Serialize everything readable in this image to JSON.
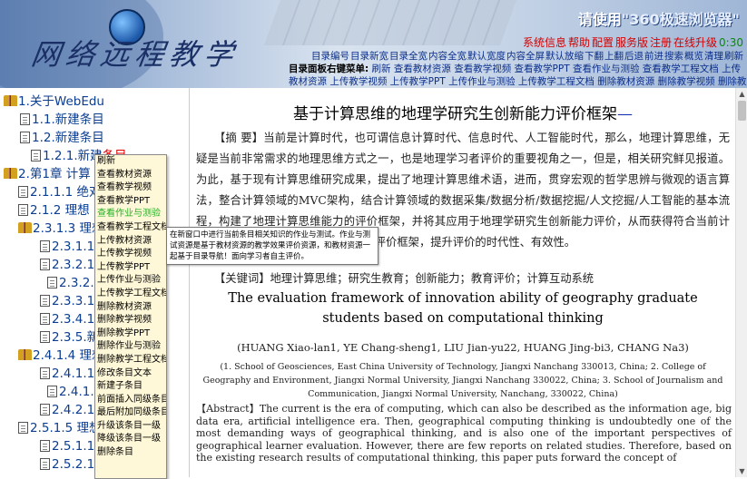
{
  "banner": {
    "logo_text": "网络远程教学",
    "welcome_prefix": "请使用",
    "welcome_browser": "\"360极速浏览器\"",
    "sys_links": [
      "系统信息",
      "帮助",
      "配置",
      "服务版",
      "注册",
      "在线升级"
    ],
    "time": "0:30",
    "nav_links": [
      "目录编号",
      "目录新宽",
      "目录全宽",
      "内容全宽",
      "默认宽度",
      "内容全屏",
      "默认放缩",
      "下翻",
      "上翻",
      "后退",
      "前进",
      "搜索",
      "概览",
      "清理",
      "刷新"
    ],
    "menu_label": "目录面板右键菜单:",
    "menu_items": "刷新 查看教材资源 查看教学视频 查看教学PPT 查看作业与测验 查看教学工程文档 上传教材资源 上传教学视频 上传教学PPT 上传作业与测验 上传教学工程文档 删除教材资源 删除教学视频 删除教学PPT 删除作"
  },
  "tree": [
    {
      "label": "1.关于WebEdu",
      "icon": "book"
    },
    {
      "label": "1.1.新建条目",
      "icon": "doc"
    },
    {
      "label": "1.2.新建条目",
      "icon": "doc"
    },
    {
      "label": "1.2.1.新建",
      "icon": "doc",
      "red": "条目"
    },
    {
      "label": "2.第1章 计算",
      "icon": "book"
    },
    {
      "label": "2.1.1.1 绝对",
      "icon": "doc"
    },
    {
      "label": "2.1.2 理想",
      "icon": "doc"
    },
    {
      "label": "2.3.1.3 理想",
      "icon": "book"
    },
    {
      "label": "2.3.1.1.3",
      "icon": "doc"
    },
    {
      "label": "2.3.2.1.3",
      "icon": "doc"
    },
    {
      "label": "2.3.2.1",
      "icon": "doc"
    },
    {
      "label": "2.3.3.1.3",
      "icon": "doc"
    },
    {
      "label": "2.3.4.1.3",
      "icon": "doc"
    },
    {
      "label": "2.3.5.新建",
      "icon": "doc"
    },
    {
      "label": "2.4.1.4 理想",
      "icon": "book"
    },
    {
      "label": "2.4.1.1.4",
      "icon": "doc"
    },
    {
      "label": "2.4.1.1",
      "icon": "doc"
    },
    {
      "label": "2.4.2.1.4",
      "icon": "doc"
    },
    {
      "label": "2.5.1.5 理想",
      "icon": "doc"
    },
    {
      "label": "2.5.1.1.5",
      "icon": "doc"
    },
    {
      "label": "2.5.2.1.5",
      "icon": "doc"
    }
  ],
  "context_menu": [
    "刷新",
    "查看教材资源",
    "查看教学视频",
    "查看教学PPT",
    "查看作业与测验",
    "查看教学工程文档",
    "上传教材资源",
    "上传教学视频",
    "上传教学PPT",
    "上传作业与测验",
    "上传教学工程文档",
    "删除教材资源",
    "删除教学视频",
    "删除教学PPT",
    "删除作业与测验",
    "删除教学工程文档",
    "修改条目文本",
    "新建子条目",
    "前面插入同级条目",
    "最后附加同级条目",
    "升级该条目一级",
    "降级该条目一级",
    "删除条目"
  ],
  "tooltip": "在新窗口中进行当前条目相关知识的作业与测试。作业与测试资源是基于教材资源的教学效果评价资源，和教材资源一起基于目录导航！面向学习者自主评价。",
  "article": {
    "title": "基于计算思维的地理学研究生创新能力评价框架",
    "title_dash": "—",
    "abstract_cn": "【摘 要】当前是计算时代，也可谓信息计算时代、信息时代、人工智能时代，那么，地理计算思维，无疑是当前非常需求的地理思维方式之一，也是地理学习者评价的重要视角之一，但是，相关研究鲜见报道。为此，基于现有计算思维研究成果，提出了地理计算思维术语，进而，贯穿宏观的哲学思辨与微观的语言算法，整合计算领域的MVC架构，结合计算领域的数据采集/数据分析/数据挖掘/人文挖掘/人工智能的基本流程，构建了地理计算思维能力的评价框架，并将其应用于地理学研究生创新能力评价，从而获得符合当前计算时代需求的地理学研究生创新能力评价框架，提升评价的时代性、有效性。",
    "keywords": "【关键词】地理计算思维；研究生教育；创新能力；教育评价；计算互动系统",
    "en_title": "The evaluation framework of innovation ability of geography graduate students based on computational thinking",
    "authors": "(HUANG Xiao-lan1, YE Chang-sheng1, LIU Jian-yu22, HUANG Jing-bi3, CHANG Na3)",
    "affiliations": "(1. School of Geosciences, East China University of Technology, Jiangxi Nanchang 330013, China; 2. College of Geography and Environment, Jiangxi Normal University, Jiangxi Nanchang 330022, China; 3. School of Journalism and Communication, Jiangxi Normal University, Nanchang, 330022, China)",
    "abstract_en": "【Abstract】The current is the era of computing, which can also be described as the information age, big data era, artificial intelligence era. Then, geographical computing thinking is undoubtedly one of the most demanding ways of geographical thinking, and is also one of the important perspectives of geographical learner evaluation. However, there are few reports on related studies. Therefore, based on the existing research results of computational thinking, this paper puts forward the concept of"
  },
  "colors": {
    "nav_blue": "#0b2e8a",
    "sys_red": "#d30000",
    "menu_active": "#22b022",
    "menu_bg": "#fff8d8"
  }
}
